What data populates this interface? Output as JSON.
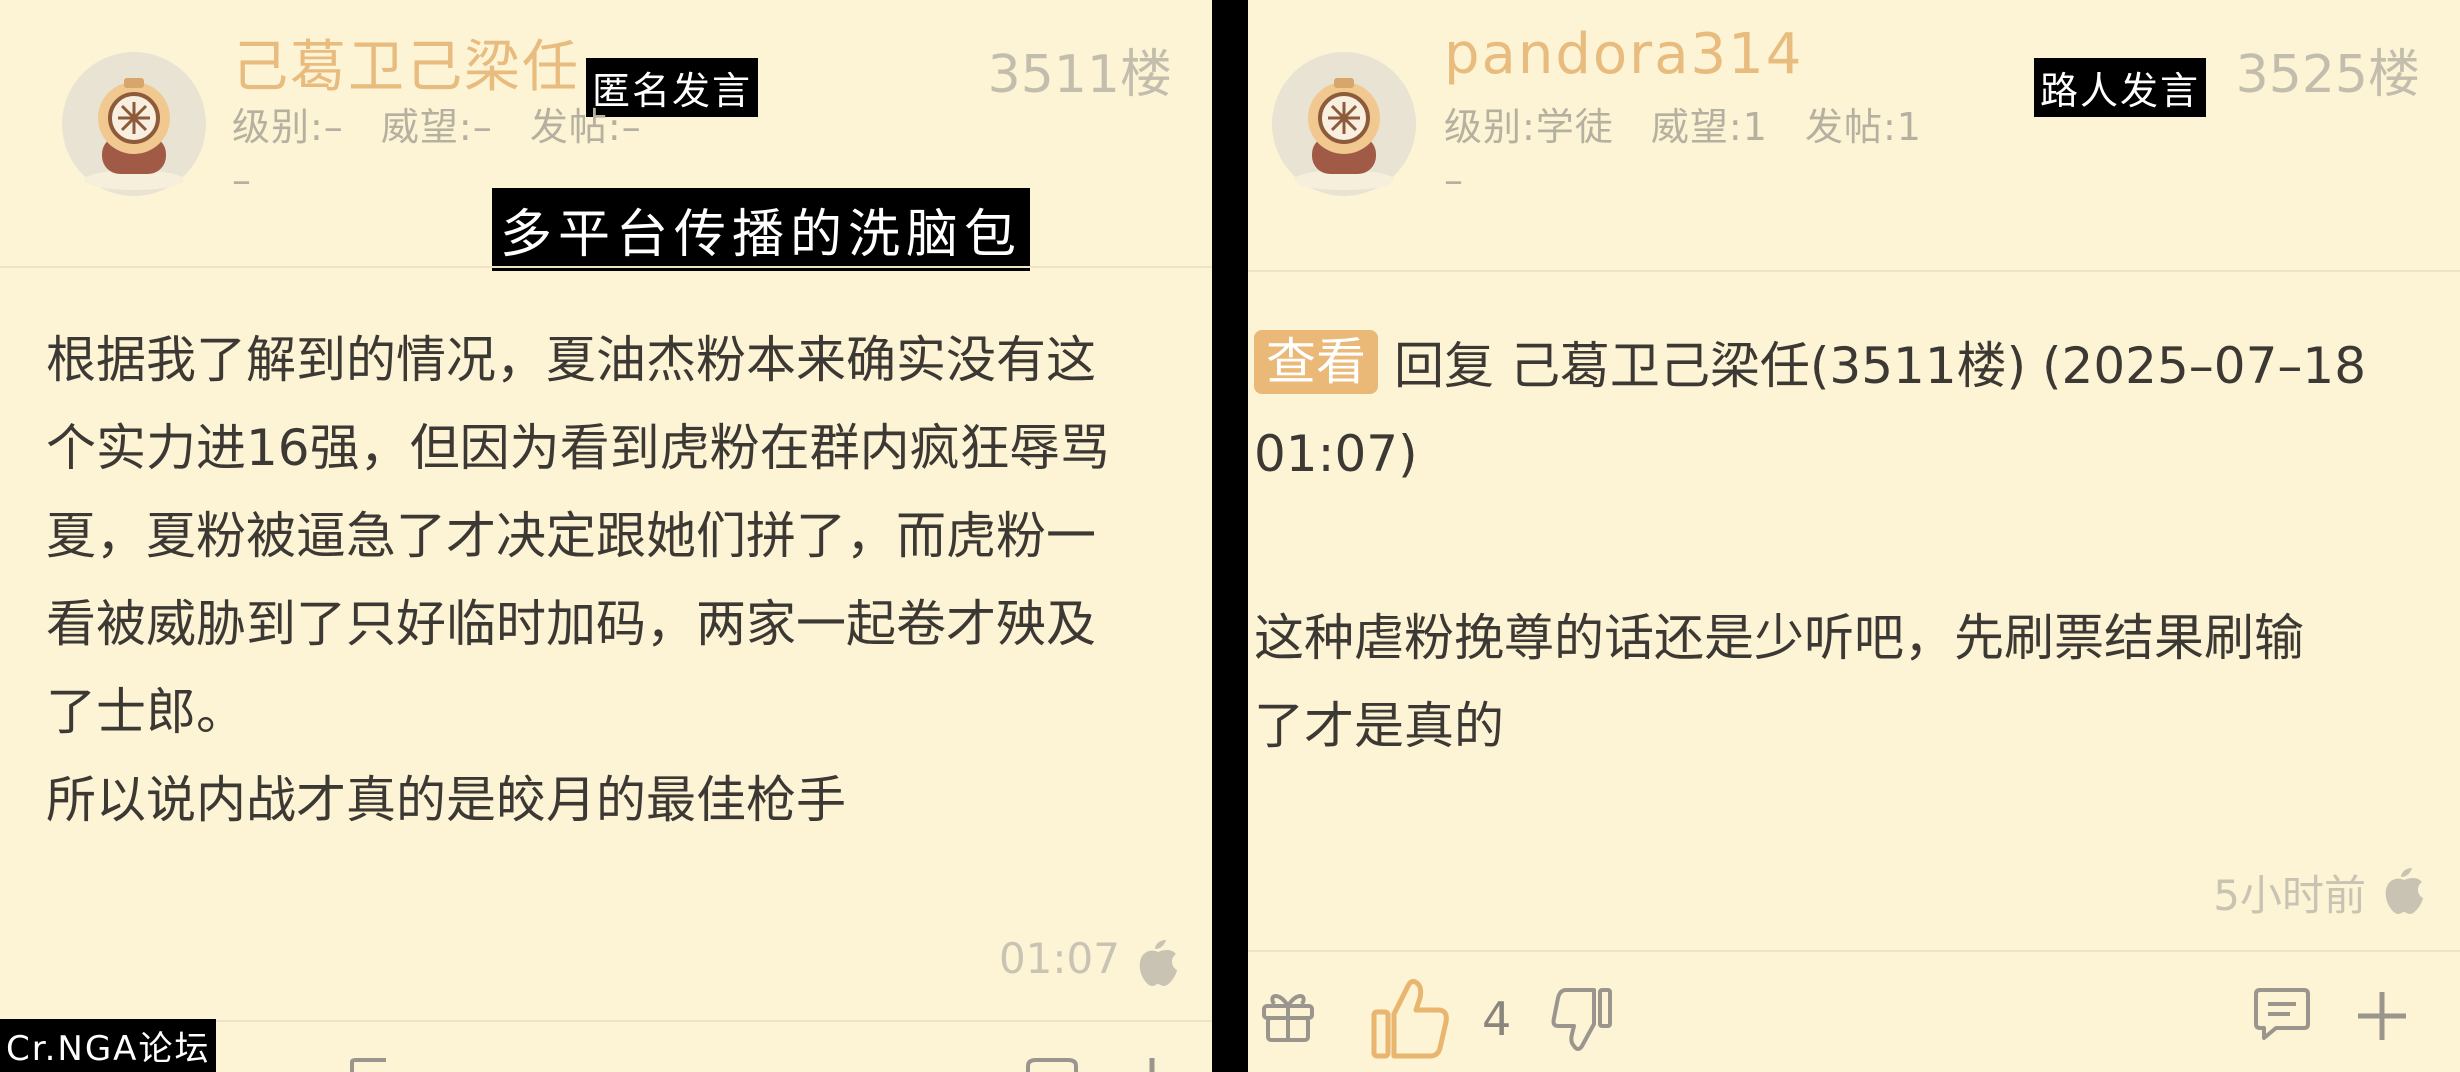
{
  "left_post": {
    "username": "己葛卫己梁任",
    "overlay_anon": "匿名发言",
    "floor": "3511楼",
    "level": "级别:–",
    "prestige": "威望:–",
    "posts": "发帖:–",
    "dash": "–",
    "overlay_title": "多平台传播的洗脑包",
    "body_lines": [
      "根据我了解到的情况，夏油杰粉本来确实没有这",
      "个实力进16强，但因为看到虎粉在群内疯狂辱骂",
      "夏，夏粉被逼急了才决定跟她们拼了，而虎粉一",
      "看被威胁到了只好临时加码，两家一起卷才殃及",
      "了士郎。",
      "所以说内战才真的是皎月的最佳枪手"
    ],
    "time": "01:07",
    "device_icon": "apple-icon"
  },
  "right_post": {
    "username": "pandora314",
    "overlay_anon": "路人发言",
    "floor": "3525楼",
    "level": "级别:学徒",
    "prestige": "威望:1",
    "posts": "发帖:1",
    "dash": "–",
    "view_tag": "查看",
    "reply_line1": "回复 己葛卫己梁任(3511楼) (2025–07–18",
    "reply_line2": "01:07)",
    "body_lines": [
      "这种虐粉挽尊的话还是少听吧，先刷票结果刷输",
      "了才是真的"
    ],
    "time": "5小时前",
    "device_icon": "apple-icon",
    "like_count": "4"
  },
  "watermark": "Cr.NGA论坛",
  "colors": {
    "background": "#fdf3d5",
    "username": "#e8bc7e",
    "meta": "#b5b0a0",
    "body_text": "#3c3833",
    "tag_bg": "#eab877",
    "like_active": "#e8b66e"
  }
}
